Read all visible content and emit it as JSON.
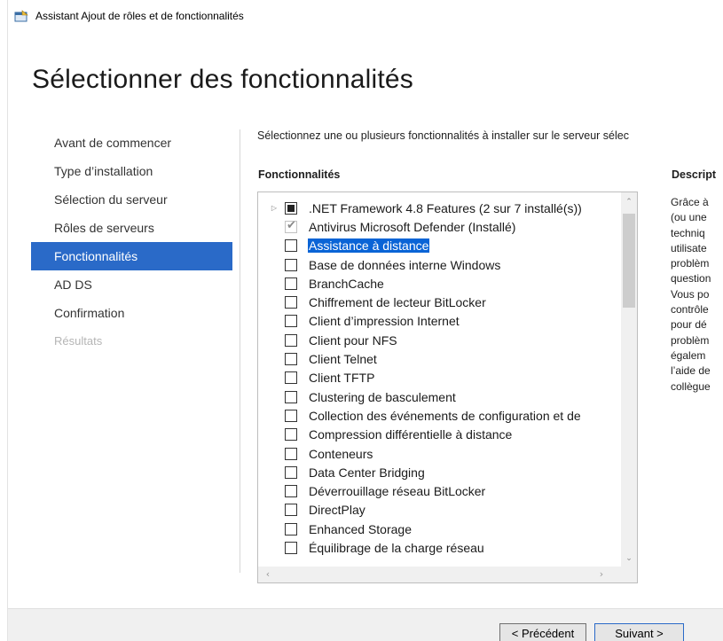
{
  "window": {
    "title": "Assistant Ajout de rôles et de fonctionnalités",
    "icon": "server-manager-icon"
  },
  "page": {
    "heading": "Sélectionner des fonctionnalités",
    "instruction": "Sélectionnez une ou plusieurs fonctionnalités à installer sur le serveur sélec"
  },
  "nav": {
    "items": [
      {
        "label": "Avant de commencer",
        "state": "normal"
      },
      {
        "label": "Type d’installation",
        "state": "normal"
      },
      {
        "label": "Sélection du serveur",
        "state": "normal"
      },
      {
        "label": "Rôles de serveurs",
        "state": "normal"
      },
      {
        "label": "Fonctionnalités",
        "state": "active"
      },
      {
        "label": "AD DS",
        "state": "normal"
      },
      {
        "label": "Confirmation",
        "state": "normal"
      },
      {
        "label": "Résultats",
        "state": "disabled"
      }
    ],
    "active_color": "#2a6ac8"
  },
  "features": {
    "column_label": "Fonctionnalités",
    "items": [
      {
        "label": ".NET Framework 4.8 Features (2 sur 7 installé(s))",
        "check": "partial",
        "expandable": true
      },
      {
        "label": "Antivirus Microsoft Defender (Installé)",
        "check": "installed"
      },
      {
        "label": "Assistance à distance",
        "check": "none",
        "selected": true
      },
      {
        "label": "Base de données interne Windows",
        "check": "none"
      },
      {
        "label": "BranchCache",
        "check": "none"
      },
      {
        "label": "Chiffrement de lecteur BitLocker",
        "check": "none"
      },
      {
        "label": "Client d’impression Internet",
        "check": "none"
      },
      {
        "label": "Client pour NFS",
        "check": "none"
      },
      {
        "label": "Client Telnet",
        "check": "none"
      },
      {
        "label": "Client TFTP",
        "check": "none"
      },
      {
        "label": "Clustering de basculement",
        "check": "none"
      },
      {
        "label": "Collection des événements de configuration et de",
        "check": "none"
      },
      {
        "label": "Compression différentielle à distance",
        "check": "none"
      },
      {
        "label": "Conteneurs",
        "check": "none"
      },
      {
        "label": "Data Center Bridging",
        "check": "none"
      },
      {
        "label": "Déverrouillage réseau BitLocker",
        "check": "none"
      },
      {
        "label": "DirectPlay",
        "check": "none"
      },
      {
        "label": "Enhanced Storage",
        "check": "none"
      },
      {
        "label": "Équilibrage de la charge réseau",
        "check": "none"
      }
    ],
    "selection_color": "#0a64d6"
  },
  "description": {
    "column_label": "Descript",
    "lines": [
      "Grâce à",
      "(ou une",
      "techniq",
      "utilisate",
      "problèm",
      "question",
      "Vous po",
      "contrôle",
      "pour dé",
      "problèm",
      "égalem",
      "l’aide de",
      "collègue"
    ]
  },
  "buttons": {
    "previous": "< Précédent",
    "next": "Suivant >"
  }
}
